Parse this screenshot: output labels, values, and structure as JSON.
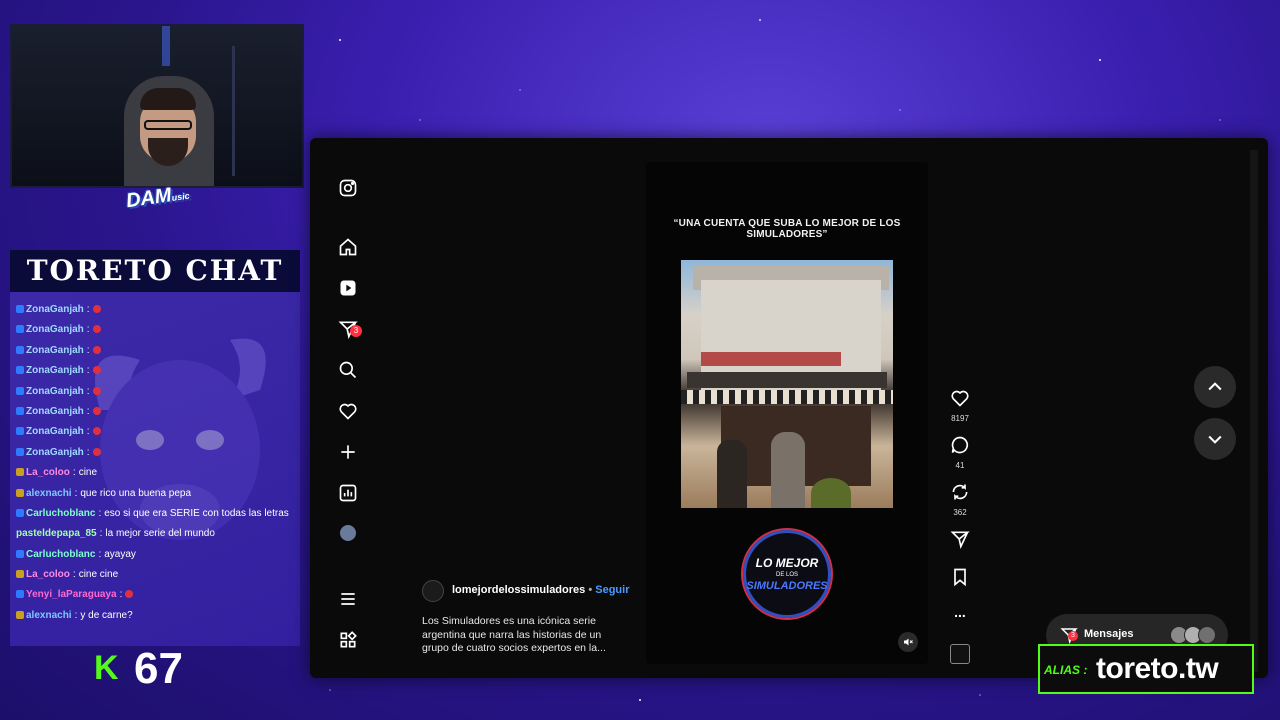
{
  "overlay": {
    "webcam_logo": "DAM",
    "webcam_logo_sub": "usic",
    "chat_title": "TORETO CHAT",
    "kick_icon": "K",
    "viewer_count": "67",
    "alias_label": "ALIAS :",
    "alias_value": "toreto.tw",
    "colors": {
      "kick_green": "#53fc18",
      "background": "#3a1fb0"
    }
  },
  "chat": {
    "messages": [
      {
        "user": "ZonaGanjah",
        "sep": ":",
        "text": "",
        "user_color": "#9fd8ff",
        "badge_color": "#2f7bff"
      },
      {
        "user": "ZonaGanjah",
        "sep": ":",
        "text": "",
        "user_color": "#9fd8ff",
        "badge_color": "#2f7bff"
      },
      {
        "user": "ZonaGanjah",
        "sep": ":",
        "text": "",
        "user_color": "#9fd8ff",
        "badge_color": "#2f7bff"
      },
      {
        "user": "ZonaGanjah",
        "sep": ":",
        "text": "",
        "user_color": "#9fd8ff",
        "badge_color": "#2f7bff"
      },
      {
        "user": "ZonaGanjah",
        "sep": ":",
        "text": "",
        "user_color": "#9fd8ff",
        "badge_color": "#2f7bff"
      },
      {
        "user": "ZonaGanjah",
        "sep": ":",
        "text": "",
        "user_color": "#9fd8ff",
        "badge_color": "#2f7bff"
      },
      {
        "user": "ZonaGanjah",
        "sep": ":",
        "text": "",
        "user_color": "#9fd8ff",
        "badge_color": "#2f7bff"
      },
      {
        "user": "ZonaGanjah",
        "sep": ":",
        "text": "",
        "user_color": "#9fd8ff",
        "badge_color": "#2f7bff"
      },
      {
        "user": "La_coloo",
        "sep": ":",
        "text": "cine",
        "user_color": "#ff8be0",
        "badge_color": "#c9a020"
      },
      {
        "user": "alexnachi",
        "sep": ":",
        "text": "que rico una buena pepa",
        "user_color": "#7fc8ff",
        "badge_color": "#c9a020"
      },
      {
        "user": "Carluchoblanc",
        "sep": ":",
        "text": "eso si que era SERIE con todas las letras",
        "user_color": "#7fffd0",
        "badge_color": "#2f7bff"
      },
      {
        "user": "pasteldepapa_85",
        "sep": ":",
        "text": "la mejor serie del mundo",
        "user_color": "#9fffb0",
        "badge_color": ""
      },
      {
        "user": "Carluchoblanc",
        "sep": ":",
        "text": "ayayay",
        "user_color": "#7fffd0",
        "badge_color": "#2f7bff"
      },
      {
        "user": "La_coloo",
        "sep": ":",
        "text": "cine cine",
        "user_color": "#ff8be0",
        "badge_color": "#c9a020"
      },
      {
        "user": "Yenyi_laParaguaya",
        "sep": ":",
        "text": "",
        "user_color": "#ff6ad0",
        "badge_color": "#2f7bff"
      },
      {
        "user": "alexnachi",
        "sep": ":",
        "text": "y de carne?",
        "user_color": "#7fc8ff",
        "badge_color": "#c9a020"
      }
    ]
  },
  "instagram": {
    "sidebar": [
      {
        "name": "instagram-logo-icon",
        "label": "Instagram"
      },
      {
        "name": "home-icon",
        "label": "Home"
      },
      {
        "name": "reels-icon",
        "label": "Reels"
      },
      {
        "name": "messages-icon",
        "label": "Messages",
        "badge": "3"
      },
      {
        "name": "search-icon",
        "label": "Search"
      },
      {
        "name": "heart-icon",
        "label": "Notifications"
      },
      {
        "name": "plus-icon",
        "label": "Create"
      },
      {
        "name": "dashboard-icon",
        "label": "Dashboard"
      },
      {
        "name": "profile-avatar",
        "label": "Profile"
      },
      {
        "name": "menu-icon",
        "label": "More"
      },
      {
        "name": "apps-icon",
        "label": "Also from Meta"
      }
    ],
    "reel": {
      "overlay_text": "“UNA CUENTA QUE SUBA LO MEJOR DE LOS SIMULADORES”",
      "logo_line1": "LO MEJOR",
      "logo_line2": "DE LOS",
      "logo_line3": "SIMULADORES",
      "mute_icon": "🔇"
    },
    "caption": {
      "username": "lomejordelossimuladores",
      "dot": "•",
      "follow": "Seguir",
      "text": "Los Simuladores es una icónica serie argentina que narra las historias de un grupo de cuatro socios expertos en la..."
    },
    "actions": {
      "likes": "8197",
      "comments": "41",
      "reposts": "362",
      "more": "..."
    },
    "messages_button": {
      "label": "Mensajes",
      "badge": "3"
    }
  }
}
